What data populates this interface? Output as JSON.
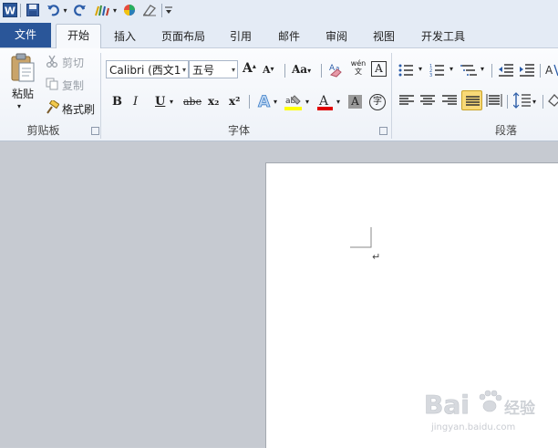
{
  "quick_access": {
    "icons": [
      "word-app-icon",
      "save-icon",
      "undo-icon",
      "undo-dropdown-icon",
      "redo-icon",
      "format-painter-icon",
      "color-wheel-icon",
      "eraser-icon",
      "customize-qat-icon"
    ]
  },
  "tabs": {
    "file": "文件",
    "home": "开始",
    "insert": "插入",
    "page_layout": "页面布局",
    "references": "引用",
    "mailings": "邮件",
    "review": "审阅",
    "view": "视图",
    "developer": "开发工具"
  },
  "clipboard": {
    "paste": "粘贴",
    "cut": "剪切",
    "copy": "复制",
    "format_painter": "格式刷",
    "group_label": "剪贴板"
  },
  "font": {
    "font_name": "Calibri (西文1",
    "font_size": "五号",
    "bold": "B",
    "italic": "I",
    "underline": "U",
    "strikethrough": "abe",
    "subscript": "x₂",
    "superscript": "x²",
    "change_case": "Aa",
    "clear_format": "A",
    "char_border": "A",
    "char_shading": "A",
    "phonetic": "wén 文",
    "enclose": "字",
    "group_label": "字体"
  },
  "paragraph": {
    "group_label": "段落"
  },
  "colors": {
    "file_tab": "#2a5699",
    "font_color_bar": "#e00000",
    "highlight_bar": "#ffff00",
    "justify_active": "#f8d977"
  },
  "watermark": {
    "brand": "Bai",
    "suffix": "经验",
    "url": "jingyan.baidu.com"
  }
}
